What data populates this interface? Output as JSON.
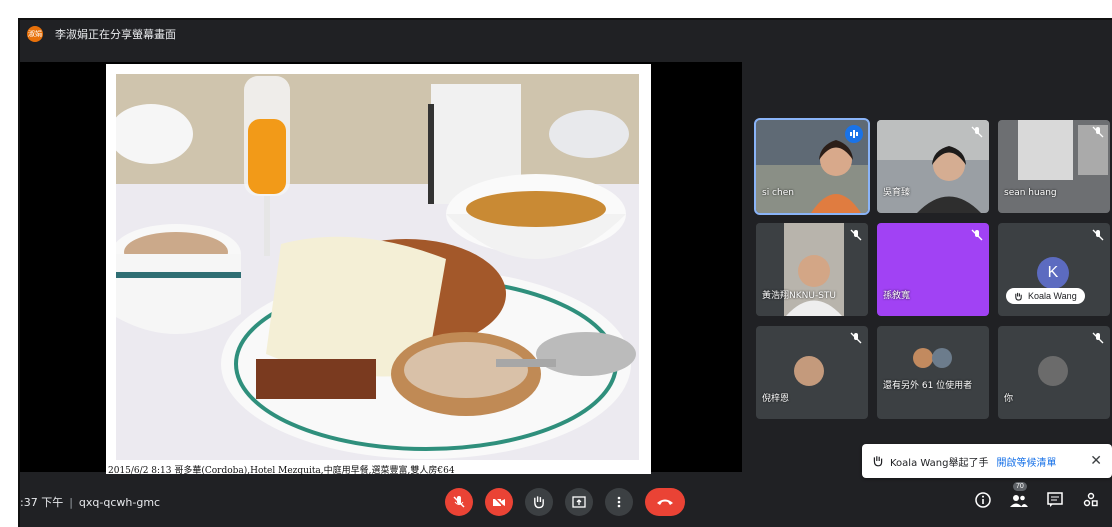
{
  "presenter": {
    "avatar_initials": "淑娟",
    "share_text": "李淑娟正在分享螢幕畫面"
  },
  "slide": {
    "caption": "2015/6/2  8:13 哥多華(Cordoba),Hotel Mezquita,中庭用早餐,選菜豐富,雙人房€64"
  },
  "participants": [
    {
      "name": "si chen",
      "state": "speaking"
    },
    {
      "name": "吳育臻",
      "state": "muted"
    },
    {
      "name": "sean huang",
      "state": "muted"
    },
    {
      "name": "黃浩翔NKNU-STU",
      "state": "muted"
    },
    {
      "name": "孫敘寬",
      "state": "muted"
    },
    {
      "name": "Koala Wang",
      "avatar_letter": "K",
      "state": "muted"
    },
    {
      "name": "倪梓恩",
      "state": "muted"
    },
    {
      "name": "還有另外 61 位使用者",
      "state": "muted"
    },
    {
      "name": "你",
      "state": "muted"
    }
  ],
  "toast": {
    "message": "Koala Wang舉起了手",
    "link": "開啟等候清單",
    "close_glyph": "✕"
  },
  "bottom": {
    "time": ":37 下午",
    "separator": "|",
    "meeting_code": "qxq-qcwh-gmc",
    "participant_count": "70"
  },
  "colors": {
    "background": "#202124",
    "tile": "#3c4043",
    "accent_blue": "#1a73e8",
    "red": "#ea4335",
    "purple_tile": "#a142f4"
  }
}
